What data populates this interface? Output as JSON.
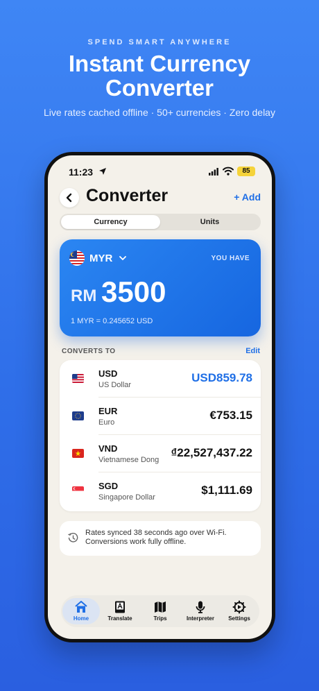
{
  "hero": {
    "eyebrow": "SPEND SMART ANYWHERE",
    "headline_line1": "Instant Currency",
    "headline_line2": "Converter",
    "subline": "Live rates cached offline · 50+ currencies · Zero delay"
  },
  "status_bar": {
    "time": "11:23",
    "battery": "85"
  },
  "header": {
    "title": "Converter",
    "add_label": "+ Add"
  },
  "segmented": {
    "tabs": [
      {
        "label": "Currency",
        "active": true
      },
      {
        "label": "Units",
        "active": false
      }
    ]
  },
  "source": {
    "code": "MYR",
    "you_have_label": "YOU HAVE",
    "prefix": "RM",
    "amount": "3500",
    "rate": "1 MYR = 0.245652 USD"
  },
  "converts": {
    "label": "CONVERTS TO",
    "edit_label": "Edit",
    "rows": [
      {
        "code": "USD",
        "name": "US Dollar",
        "value": "USD859.78"
      },
      {
        "code": "EUR",
        "name": "Euro",
        "value": "€753.15"
      },
      {
        "code": "VND",
        "name": "Vietnamese Dong",
        "value": "₫22,527,437.22"
      },
      {
        "code": "SGD",
        "name": "Singapore Dollar",
        "value": "$1,111.69"
      }
    ]
  },
  "sync": {
    "line1": "Rates synced 38 seconds ago over Wi-Fi.",
    "line2": "Conversions work fully offline."
  },
  "tabbar": {
    "items": [
      {
        "label": "Home",
        "icon": "home-icon"
      },
      {
        "label": "Translate",
        "icon": "translate-icon"
      },
      {
        "label": "Trips",
        "icon": "map-icon"
      },
      {
        "label": "Interpreter",
        "icon": "microphone-icon"
      },
      {
        "label": "Settings",
        "icon": "gear-icon"
      }
    ]
  },
  "colors": {
    "accent": "#1f6fe6",
    "background": "#3f86f5",
    "screen": "#f4f1ea",
    "battery": "#f5d33a"
  }
}
